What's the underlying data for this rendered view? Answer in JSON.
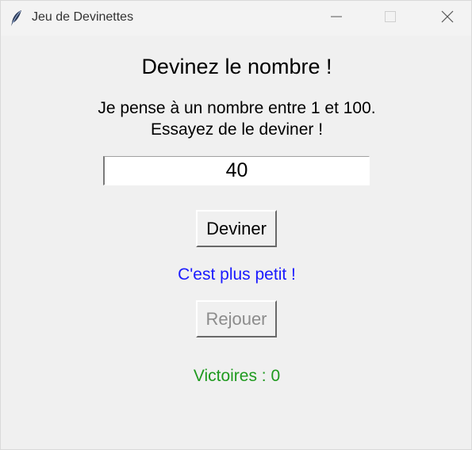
{
  "window": {
    "title": "Jeu de Devinettes"
  },
  "titlebar_icons": {
    "app": "feather-icon",
    "minimize": "minimize-icon",
    "maximize": "maximize-icon",
    "close": "close-icon"
  },
  "game": {
    "heading": "Devinez le nombre !",
    "instruction_line1": "Je pense à un nombre entre 1 et 100.",
    "instruction_line2": "Essayez de le deviner !",
    "guess_value": "40",
    "guess_button_label": "Deviner",
    "feedback": "C'est plus petit !",
    "replay_button_label": "Rejouer",
    "replay_enabled": false,
    "wins_label": "Victoires : 0"
  },
  "colors": {
    "background": "#f0f0f0",
    "feedback": "#1a1aff",
    "wins": "#1f9a1f",
    "disabled_text": "#8c8c8c"
  }
}
